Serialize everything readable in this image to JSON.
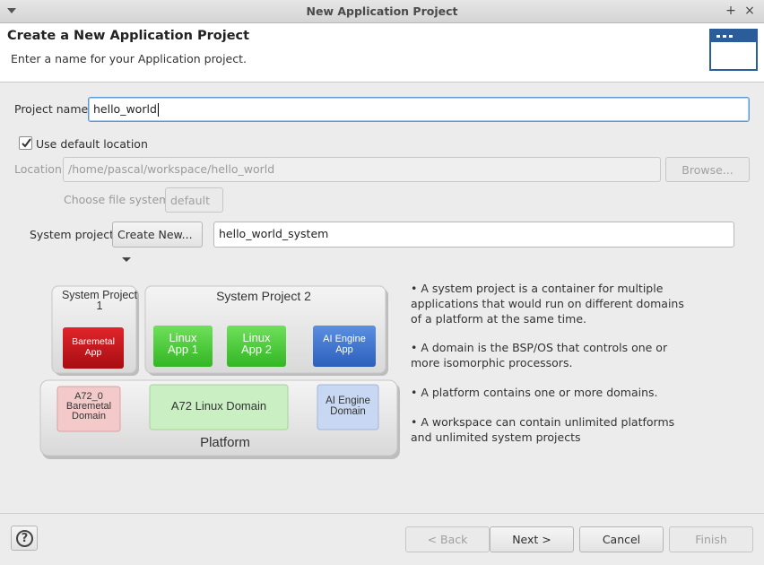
{
  "window": {
    "title": "New Application Project"
  },
  "header": {
    "title": "Create a New Application Project",
    "subtitle": "Enter a name for your Application project."
  },
  "form": {
    "project_name_label": "Project name:",
    "project_name_value": "hello_world",
    "use_default_location_label": "Use default location",
    "use_default_location_checked": true,
    "location_label": "Location:",
    "location_value": "/home/pascal/workspace/hello_world",
    "browse_label": "Browse...",
    "file_system_label": "Choose file system:",
    "file_system_value": "default",
    "system_project_label": "System project:",
    "system_project_select": "Create New...",
    "system_project_value": "hello_world_system"
  },
  "diagram": {
    "system_project_1": "System Project 1",
    "system_project_2": "System Project 2",
    "baremetal_app": "Baremetal App",
    "linux_app_1": "Linux App 1",
    "linux_app_2": "Linux App 2",
    "ai_engine_app": "AI Engine App",
    "a72_baremetal_domain": "A72_0 Baremetal Domain",
    "a72_linux_domain": "A72 Linux Domain",
    "ai_engine_domain": "AI Engine Domain",
    "platform": "Platform"
  },
  "info": [
    "• A system project is a container for multiple applications that would run on different domains of a platform at the same time.",
    "• A domain is the BSP/OS that controls one or more isomorphic processors.",
    "• A platform contains one or more domains.",
    "• A workspace can contain unlimited platforms and unlimited system projects"
  ],
  "footer": {
    "back_label": "< Back",
    "next_label": "Next >",
    "cancel_label": "Cancel",
    "finish_label": "Finish"
  }
}
